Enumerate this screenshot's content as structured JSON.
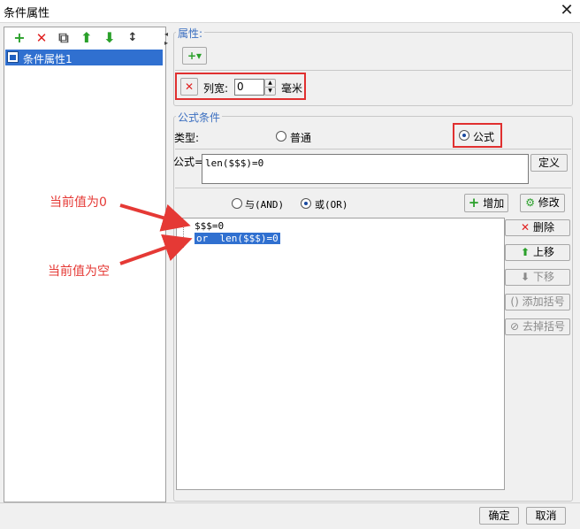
{
  "window": {
    "title": "条件属性",
    "close_glyph": "✕"
  },
  "left_toolbar": {
    "add": "+",
    "delete": "✕",
    "copy": "⧉",
    "up": "⬆",
    "down": "⬇",
    "sort": "↕"
  },
  "tree": {
    "items": [
      {
        "label": "条件属性1"
      }
    ]
  },
  "attr_group": {
    "label": "属性:",
    "add_label": "+▾"
  },
  "column_width": {
    "delete_glyph": "✕",
    "label": "列宽:",
    "value": "0",
    "unit": "毫米"
  },
  "formula_group": {
    "label": "公式条件",
    "type_label": "类型:",
    "radio_normal": "普通",
    "radio_formula": "公式",
    "formula_label": "公式=",
    "formula_value": "len($$$)=0",
    "define_button": "定义"
  },
  "logic": {
    "and_label": "与(AND)",
    "or_label": "或(OR)",
    "add_button": "增加",
    "modify_button": "修改",
    "selected": "或"
  },
  "conditions": [
    {
      "text": "$$$=0",
      "selected": false
    },
    {
      "text": "or  len($$$)=0",
      "selected": true
    }
  ],
  "side_buttons": {
    "delete": "删除",
    "move_up": "上移",
    "move_down": "下移",
    "add_bracket": "添加括号",
    "remove_bracket": "去掉括号"
  },
  "footer": {
    "ok": "确定",
    "cancel": "取消"
  },
  "annotations": {
    "first": "当前值为0",
    "second": "当前值为空"
  },
  "colors": {
    "accent": "#3070d0",
    "highlight": "#e03030",
    "green": "#2aa02a",
    "red": "#e02020"
  }
}
